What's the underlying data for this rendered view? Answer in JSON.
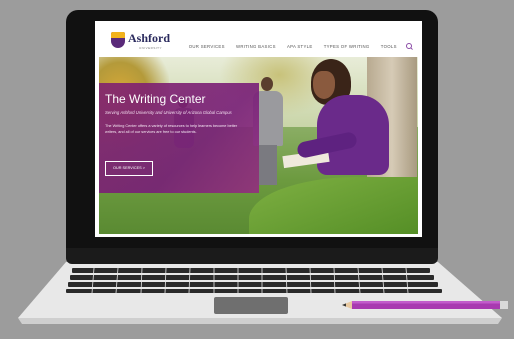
{
  "logo": {
    "name": "Ashford",
    "sub": "UNIVERSITY"
  },
  "nav": {
    "items": [
      "OUR SERVICES",
      "WRITING BASICS",
      "APA STYLE",
      "TYPES OF WRITING",
      "TOOLS"
    ],
    "search_icon": "search-icon"
  },
  "hero": {
    "title": "The Writing Center",
    "subtitle": "Serving Ashford University and University of Arizona Global Campus",
    "text": "The Writing Center offers a variety of resources to help learners become better writers, and all of our services are free to our students.",
    "button": "OUR SERVICES  >"
  },
  "colors": {
    "accent": "#8a2a86",
    "logo_gold": "#f2b21b",
    "logo_purple": "#5a2a7a",
    "background": "#9c9c9c",
    "pencil": "#a83ab0"
  }
}
